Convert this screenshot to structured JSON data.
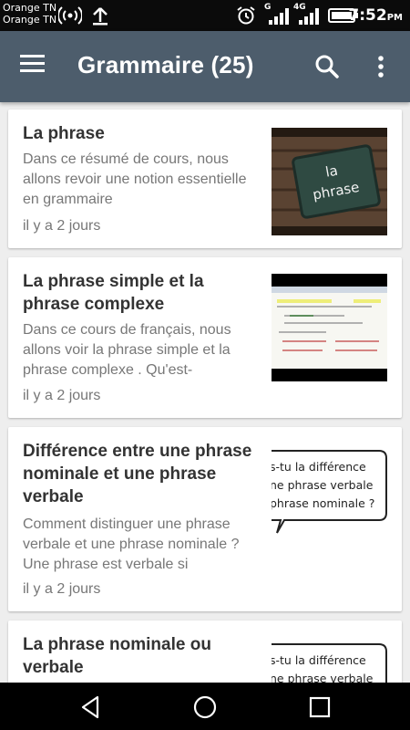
{
  "status": {
    "carrier1": "Orange TN",
    "carrier2": "Orange TN",
    "net1": "G",
    "net2": "4G",
    "time": "7:52",
    "ampm": "PM"
  },
  "appbar": {
    "title": "Grammaire (25)"
  },
  "articles": [
    {
      "title": "La phrase",
      "description": "Dans ce résumé de cours, nous allons revoir une notion essentielle en grammaire",
      "date": "il y a 2 jours",
      "thumb_text": [
        "la",
        "phrase"
      ]
    },
    {
      "title": "La phrase simple et la phrase complexe",
      "description": "Dans ce cours de français, nous allons voir  la phrase simple et la phrase complexe . Qu'est-",
      "date": "il y a 2 jours"
    },
    {
      "title": "Différence entre une phrase nominale et une phrase verbale",
      "description": "Comment distinguer une phrase verbale et une phrase nominale ? Une  phrase  est  verbale   si",
      "date": "il y a 2 jours",
      "thumb_text": [
        "s-tu la différence",
        "ne phrase verbale",
        "phrase nominale ?"
      ]
    },
    {
      "title": "La phrase nominale ou verbale",
      "thumb_text": [
        "s-tu la différence",
        "ne phrase verbale"
      ]
    }
  ],
  "colors": {
    "appbar": "#4d5d6c",
    "background": "#eeeeee",
    "title_text": "#333333",
    "secondary_text": "#777777"
  }
}
